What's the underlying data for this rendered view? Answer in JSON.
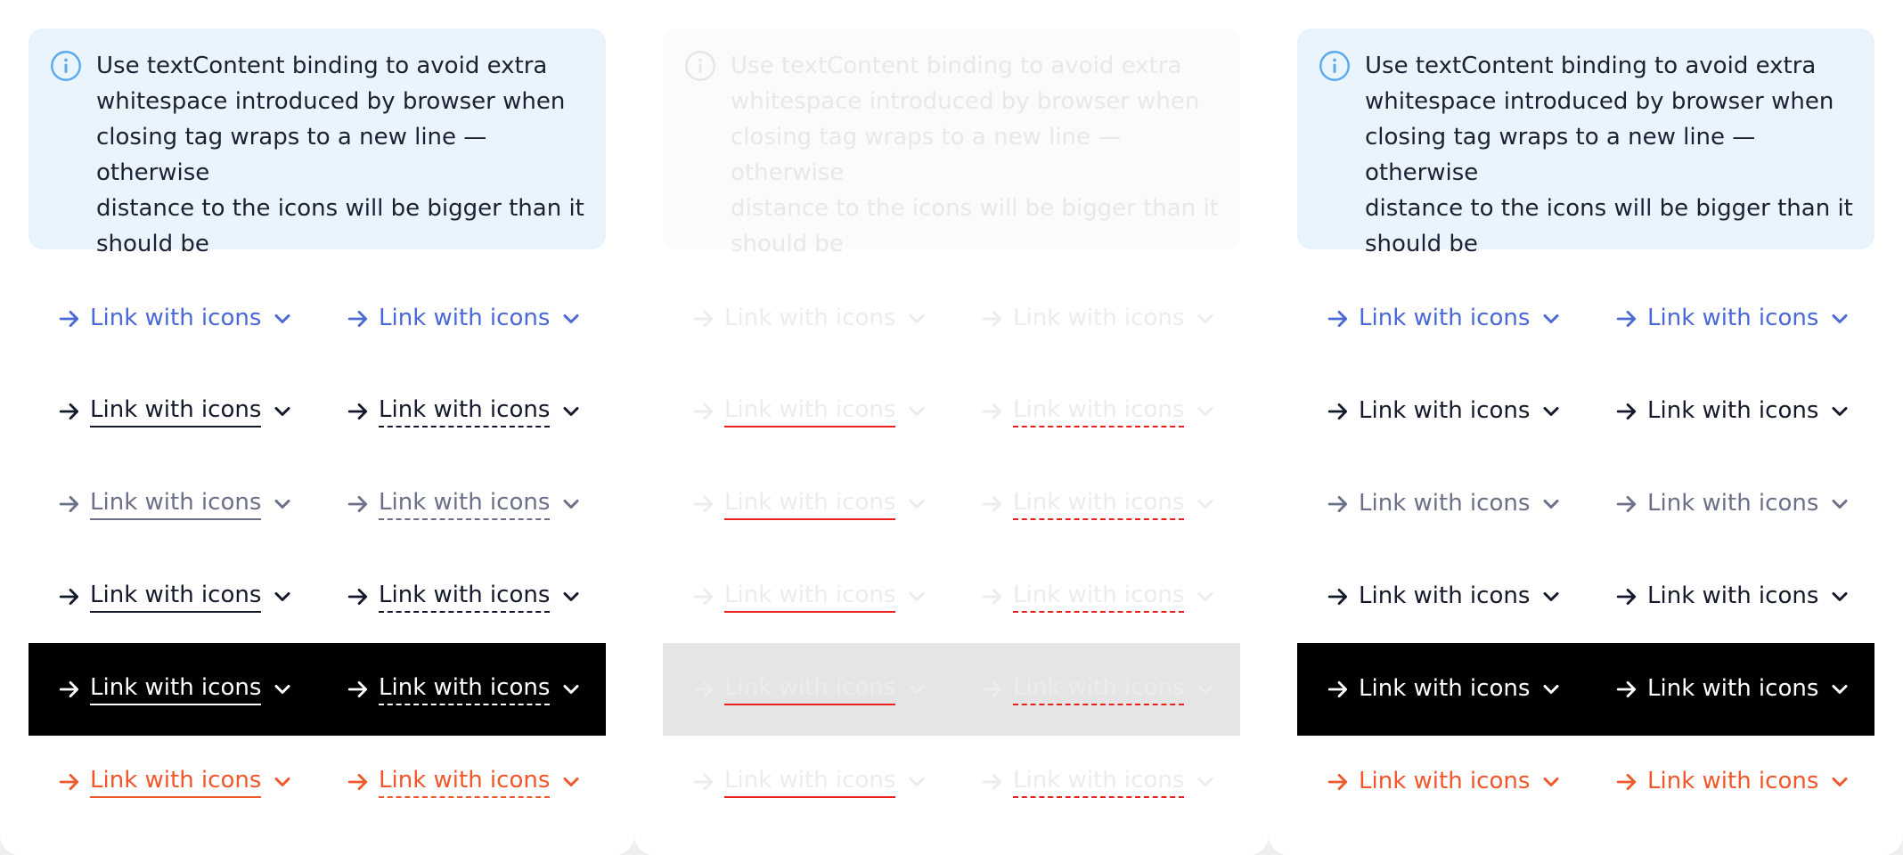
{
  "notice": {
    "icon": "info-icon",
    "lines": [
      "Use textContent binding to avoid extra",
      "whitespace introduced by browser when",
      "closing tag wraps to a new line — otherwise",
      "distance to the icons will be bigger than it",
      "should be"
    ]
  },
  "link": {
    "label": "Link with icons",
    "leading_icon": "arrow-right-icon",
    "trailing_icon": "chevron-down-icon"
  },
  "variant_colors": {
    "primary": "#4a68d6",
    "default": "#14182b",
    "muted": "#6b7088",
    "contrast": "#ffffff",
    "danger": "#f0572a",
    "disabled": "#ececee",
    "error_underline": "#e8211f",
    "dark_row_bg": "#000000",
    "info_icon": "#5aa9ec"
  }
}
